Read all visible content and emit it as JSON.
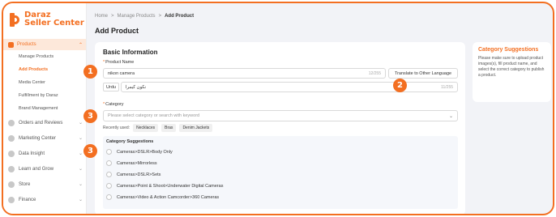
{
  "brand": {
    "line1": "Daraz",
    "line2": "Seller Center",
    "accent": "#f36f21"
  },
  "sidebar": {
    "products_label": "Products",
    "sub_items": [
      "Manage Products",
      "Add Products",
      "Media Center",
      "Fulfillment by Daraz",
      "Brand Management"
    ],
    "groups": [
      "Orders and Reviews",
      "Marketing Center",
      "Data Insight",
      "Learn and Grow",
      "Store",
      "Finance"
    ]
  },
  "breadcrumb": {
    "home": "Home",
    "sep": ">",
    "manage": "Manage Products",
    "current": "Add Product"
  },
  "page": {
    "title": "Add Product"
  },
  "basic": {
    "title": "Basic Information",
    "product_name_label": "Product Name",
    "product_name_value": "nikon camera",
    "product_name_count": "12/255",
    "translate_button": "Translate to Other Language",
    "urdu_tag": "Urdu",
    "urdu_value": "نکون کیمرا",
    "urdu_count": "11/255",
    "category_label": "Category",
    "category_placeholder": "Please select category or search with keyword",
    "recently_used_label": "Recently used:",
    "recent_chips": [
      "Necklaces",
      "Bras",
      "Denim Jackets"
    ],
    "suggestions_title": "Category Suggestions",
    "suggestions": [
      "Cameras>DSLR>Body Only",
      "Cameras>Mirrorless",
      "Cameras>DSLR>Sets",
      "Cameras>Point & Shoot>Underwater Digital Cameras",
      "Cameras>Video & Action Camcorder>360 Cameras"
    ]
  },
  "side_card": {
    "title": "Category Suggestions",
    "text": "Please make sure to upload product images(s), fill product name, and select the correct category to publish a product."
  },
  "badges": [
    "1",
    "2",
    "3",
    "3"
  ]
}
